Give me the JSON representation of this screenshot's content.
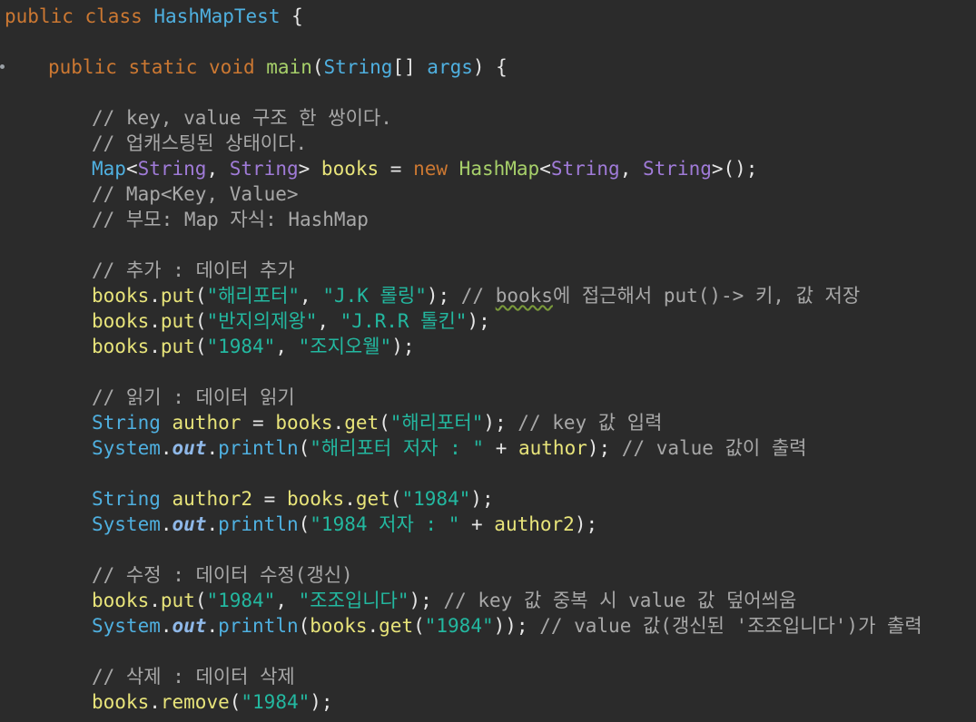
{
  "code": {
    "l1": {
      "kw1": "public",
      "kw2": "class",
      "name": "HashMapTest",
      "brace": " {"
    },
    "l3": {
      "kw1": "public",
      "kw2": "static",
      "kw3": "void",
      "name": "main",
      "p1": "(",
      "type": "String",
      "p2": "[] ",
      "arg": "args",
      "p3": ") {"
    },
    "l5": "// key, value 구조 한 쌍이다.",
    "l6": "// 업캐스팅된 상태이다.",
    "l7": {
      "t1": "Map",
      "lt1": "<",
      "g1": "String",
      "comma": ", ",
      "g2": "String",
      "gt1": ">",
      "sp": " ",
      "var": "books",
      "eq": " = ",
      "kw": "new",
      "sp2": " ",
      "t2": "HashMap",
      "lt2": "<",
      "g3": "String",
      "comma2": ", ",
      "g4": "String",
      "gt2": ">",
      "end": "();"
    },
    "l8": "// Map<Key, Value>",
    "l9": "// 부모: Map 자식: HashMap",
    "l11": "// 추가 : 데이터 추가",
    "l12": {
      "obj": "books",
      "dot": ".",
      "m": "put",
      "open": "(",
      "s1": "\"해리포터\"",
      "c": ", ",
      "s2": "\"J.K 롤링\"",
      "close": "); ",
      "cmt1": "// ",
      "cmt_books": "books",
      "cmt2": "에 접근해서 put()-> 키, 값 저장"
    },
    "l13": {
      "obj": "books",
      "dot": ".",
      "m": "put",
      "open": "(",
      "s1": "\"반지의제왕\"",
      "c": ", ",
      "s2": "\"J.R.R 톨킨\"",
      "close": ");"
    },
    "l14": {
      "obj": "books",
      "dot": ".",
      "m": "put",
      "open": "(",
      "s1": "\"1984\"",
      "c": ", ",
      "s2": "\"조지오웰\"",
      "close": ");"
    },
    "l16": "// 읽기 : 데이터 읽기",
    "l17": {
      "type": "String",
      "sp": " ",
      "var": "author",
      "eq": " = ",
      "obj": "books",
      "dot": ".",
      "m": "get",
      "open": "(",
      "s1": "\"해리포터\"",
      "close": "); ",
      "cmt": "// key 값 입력"
    },
    "l18": {
      "cls": "System",
      "dot": ".",
      "field": "out",
      "dot2": ".",
      "m": "println",
      "open": "(",
      "s1": "\"해리포터 저자 : \"",
      "plus": " + ",
      "var": "author",
      "close": "); ",
      "cmt": "// value 값이 출력"
    },
    "l20": {
      "type": "String",
      "sp": " ",
      "var": "author2",
      "eq": " = ",
      "obj": "books",
      "dot": ".",
      "m": "get",
      "open": "(",
      "s1": "\"1984\"",
      "close": ");"
    },
    "l21": {
      "cls": "System",
      "dot": ".",
      "field": "out",
      "dot2": ".",
      "m": "println",
      "open": "(",
      "s1": "\"1984 저자 : \"",
      "plus": " + ",
      "var": "author2",
      "close": ");"
    },
    "l23": "// 수정 : 데이터 수정(갱신)",
    "l24": {
      "obj": "books",
      "dot": ".",
      "m": "put",
      "open": "(",
      "s1": "\"1984\"",
      "c": ", ",
      "s2": "\"조조입니다\"",
      "close": "); ",
      "cmt": "// key 값 중복 시 value 값 덮어씌움"
    },
    "l25": {
      "cls": "System",
      "dot": ".",
      "field": "out",
      "dot2": ".",
      "m": "println",
      "open": "(",
      "obj": "books",
      "dot3": ".",
      "m2": "get",
      "open2": "(",
      "s1": "\"1984\"",
      "close": ")); ",
      "cmt": "// value 값(갱신된 '조조입니다')가 출력"
    },
    "l27": "// 삭제 : 데이터 삭제",
    "l28": {
      "obj": "books",
      "dot": ".",
      "m": "remove",
      "open": "(",
      "s1": "\"1984\"",
      "close": ");"
    }
  },
  "colors": {
    "background": "#2b2b2b",
    "keyword": "#cc7832",
    "type": "#4fb0e0",
    "generic": "#a07bd8",
    "variable": "#e8e47a",
    "string": "#23b8a0",
    "comment": "#a8a8a8",
    "method_decl": "#a7d06a"
  }
}
